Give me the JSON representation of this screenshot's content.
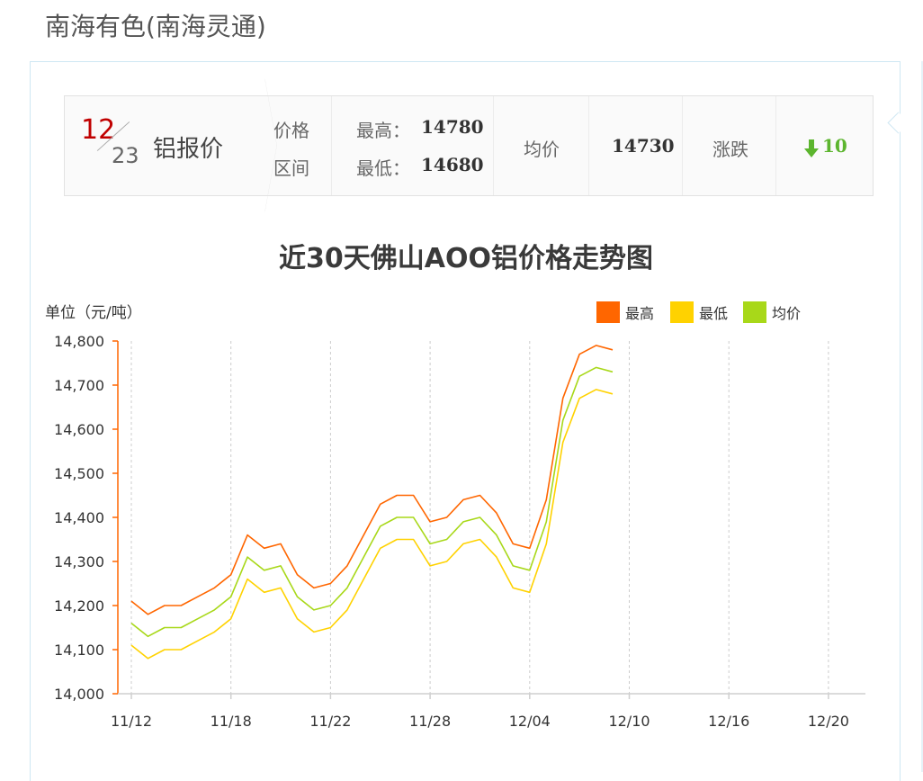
{
  "site": {
    "title": "南海有色(南海灵通)"
  },
  "price_card": {
    "date_month": "12",
    "date_day": "23",
    "product": "铝报价",
    "range_label_1": "价格",
    "range_label_2": "区间",
    "high_label": "最高：",
    "high_value": "14780",
    "low_label": "最低：",
    "low_value": "14680",
    "avg_label": "均价",
    "avg_value": "14730",
    "change_label": "涨跌",
    "change_value": "10",
    "change_direction": "down",
    "change_color": "#5cb52e"
  },
  "chart_data": {
    "type": "line",
    "title": "近30天佛山AOO铝价格走势图",
    "ylabel": "单位（元/吨）",
    "ylim": [
      14000,
      14800
    ],
    "yticks": [
      "14,000",
      "14,100",
      "14,200",
      "14,300",
      "14,400",
      "14,500",
      "14,600",
      "14,700",
      "14,800"
    ],
    "ytick_values": [
      14000,
      14100,
      14200,
      14300,
      14400,
      14500,
      14600,
      14700,
      14800
    ],
    "x": [
      "11/12",
      "11/13",
      "11/14",
      "11/15",
      "11/16",
      "11/17",
      "11/18",
      "11/19",
      "11/20",
      "11/21",
      "11/22",
      "11/23",
      "11/24",
      "11/25",
      "11/26",
      "11/27",
      "11/28",
      "11/29",
      "11/30",
      "12/01",
      "12/02",
      "12/03",
      "12/04",
      "12/05",
      "12/06",
      "12/07",
      "12/08",
      "12/09",
      "12/10",
      "12/11",
      "12/12",
      "12/13",
      "12/14",
      "12/15",
      "12/16",
      "12/17",
      "12/18",
      "12/19",
      "12/20",
      "12/21"
    ],
    "xticks": [
      "11/12",
      "11/18",
      "11/22",
      "11/28",
      "12/04",
      "12/10",
      "12/16",
      "12/20"
    ],
    "xtick_index": [
      0,
      6,
      12,
      18,
      24,
      30,
      36,
      42
    ],
    "n_points": 29,
    "grid": "vertical dashed",
    "legend_position": "top-right",
    "series": [
      {
        "name": "最高",
        "color": "#ff6600",
        "values": [
          14210,
          14180,
          14200,
          14200,
          14220,
          14240,
          14270,
          14360,
          14330,
          14340,
          14270,
          14240,
          14250,
          14290,
          14360,
          14430,
          14450,
          14450,
          14390,
          14400,
          14440,
          14450,
          14410,
          14340,
          14330,
          14440,
          14670,
          14770,
          14790,
          14780
        ]
      },
      {
        "name": "最低",
        "color": "#ffd200",
        "values": [
          14110,
          14080,
          14100,
          14100,
          14120,
          14140,
          14170,
          14260,
          14230,
          14240,
          14170,
          14140,
          14150,
          14190,
          14260,
          14330,
          14350,
          14350,
          14290,
          14300,
          14340,
          14350,
          14310,
          14240,
          14230,
          14340,
          14570,
          14670,
          14690,
          14680
        ]
      },
      {
        "name": "均价",
        "color": "#a8d819",
        "values": [
          14160,
          14130,
          14150,
          14150,
          14170,
          14190,
          14220,
          14310,
          14280,
          14290,
          14220,
          14190,
          14200,
          14240,
          14310,
          14380,
          14400,
          14400,
          14340,
          14350,
          14390,
          14400,
          14360,
          14290,
          14280,
          14390,
          14620,
          14720,
          14740,
          14730
        ]
      }
    ]
  }
}
